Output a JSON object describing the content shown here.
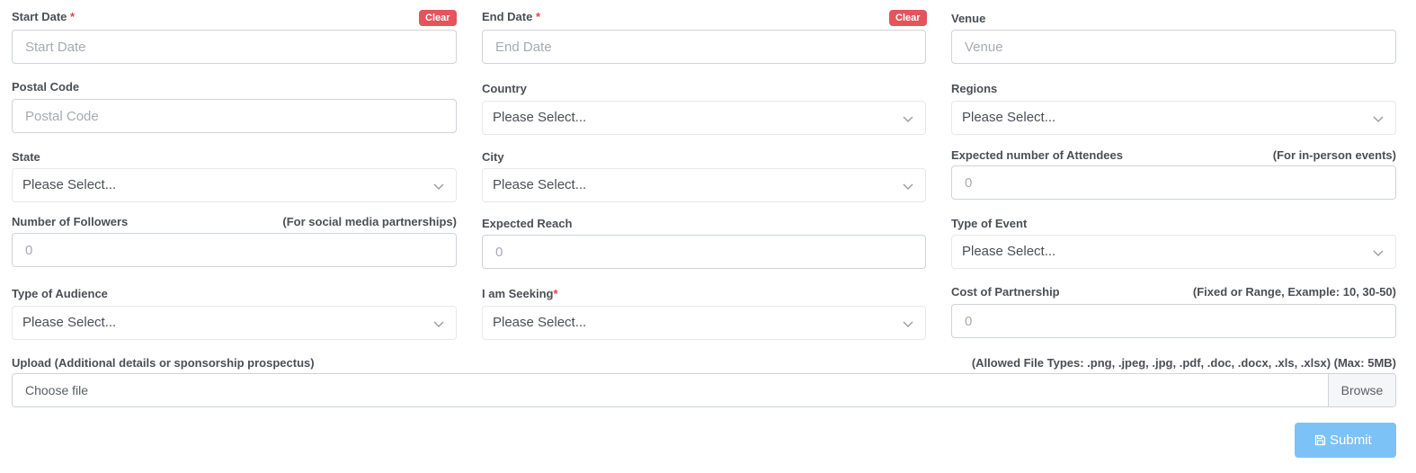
{
  "form": {
    "start_date": {
      "label": "Start Date",
      "required": "*",
      "clear": "Clear",
      "placeholder": "Start Date"
    },
    "end_date": {
      "label": "End Date",
      "required": "*",
      "clear": "Clear",
      "placeholder": "End Date"
    },
    "venue": {
      "label": "Venue",
      "placeholder": "Venue"
    },
    "postal_code": {
      "label": "Postal Code",
      "placeholder": "Postal Code"
    },
    "country": {
      "label": "Country",
      "value": "Please Select..."
    },
    "regions": {
      "label": "Regions",
      "value": "Please Select..."
    },
    "state": {
      "label": "State",
      "value": "Please Select..."
    },
    "city": {
      "label": "City",
      "value": "Please Select..."
    },
    "attendees": {
      "label": "Expected number of Attendees",
      "hint": "(For in-person events)",
      "placeholder": "0"
    },
    "followers": {
      "label": "Number of Followers",
      "hint": "(For social media partnerships)",
      "placeholder": "0"
    },
    "reach": {
      "label": "Expected Reach",
      "placeholder": "0"
    },
    "event_type": {
      "label": "Type of Event",
      "value": "Please Select..."
    },
    "audience_type": {
      "label": "Type of Audience",
      "value": "Please Select..."
    },
    "seeking": {
      "label": "I am Seeking",
      "required": "*",
      "value": "Please Select..."
    },
    "cost": {
      "label": "Cost of Partnership",
      "hint": "(Fixed or Range, Example: 10, 30-50)",
      "placeholder": "0"
    },
    "upload": {
      "label": "Upload (Additional details or sponsorship prospectus)",
      "hint": "(Allowed File Types: .png, .jpeg, .jpg, .pdf, .doc, .docx, .xls, .xlsx) (Max: 5MB)",
      "file_text": "Choose file",
      "browse": "Browse"
    },
    "submit_label": "Submit"
  },
  "colors": {
    "required": "#e0434b",
    "clear_badge": "#e5535c",
    "submit": "#7cc2f7"
  },
  "icons": {
    "select": "chevron-down-icon",
    "submit": "save-icon"
  }
}
